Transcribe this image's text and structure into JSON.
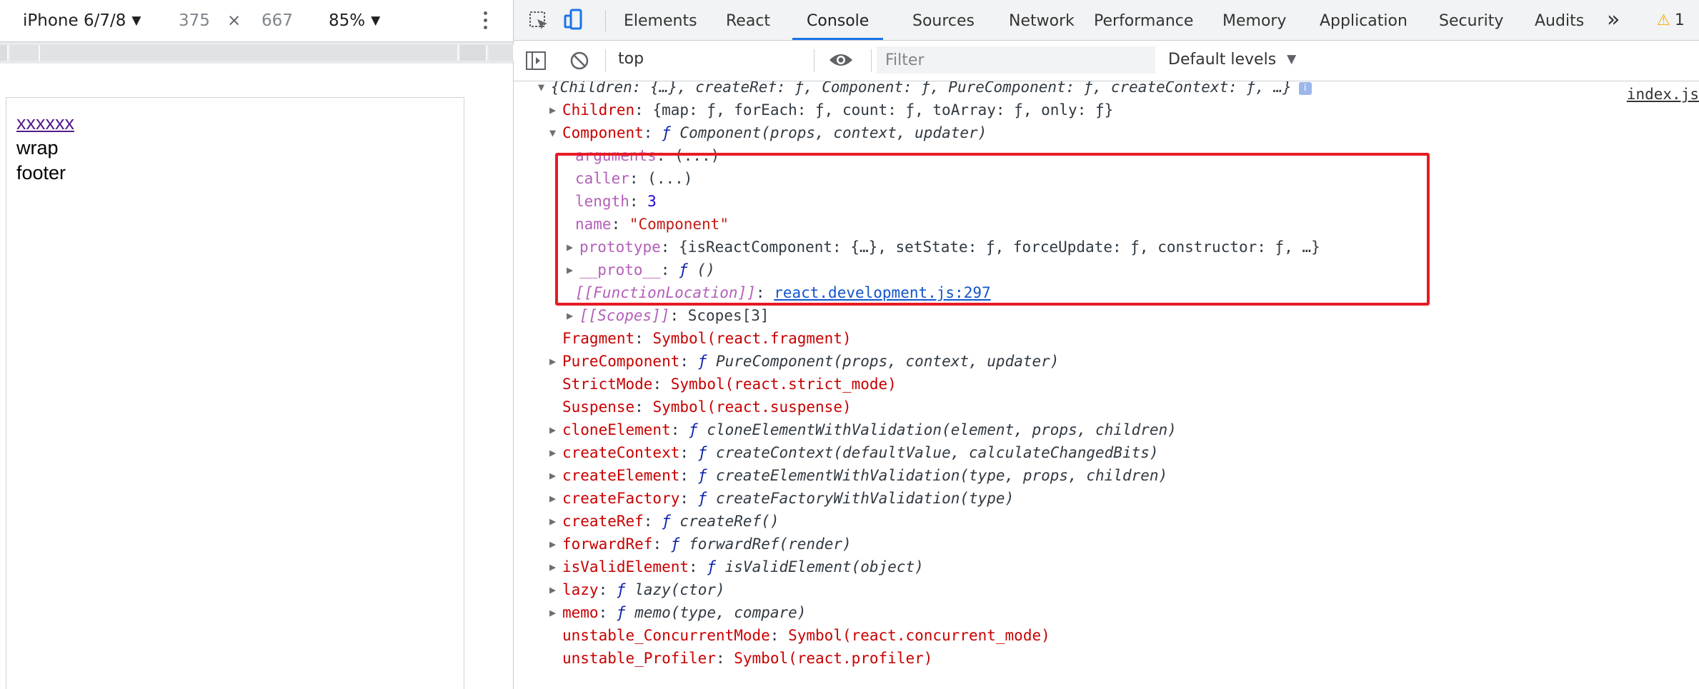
{
  "device_toolbar": {
    "device": "iPhone 6/7/8",
    "width": "375",
    "times": "×",
    "height": "667",
    "zoom": "85%",
    "caret": "▼"
  },
  "viewport": {
    "link_text": "xxxxxx",
    "wrap_text": "wrap",
    "footer_text": "footer"
  },
  "devtools": {
    "tabs": [
      "Elements",
      "React",
      "Console",
      "Sources",
      "Network",
      "Performance",
      "Memory",
      "Application",
      "Security",
      "Audits"
    ],
    "active_tab": "Console",
    "more_tabs": "»",
    "warning_icon": "⚠",
    "warning_count": "1"
  },
  "console_toolbar": {
    "context": "top",
    "filter_placeholder": "Filter",
    "levels": "Default levels",
    "caret": "▼"
  },
  "console": {
    "source_link": "index.js",
    "root": {
      "expanded_arrow": "▼",
      "summary": "{Children: {…}, createRef: ƒ, Component: ƒ, PureComponent: ƒ, createContext: ƒ, …}",
      "info": "i"
    },
    "rows": {
      "children": {
        "arrow": "▶",
        "key": "Children",
        "value": "{map: ƒ, forEach: ƒ, count: ƒ, toArray: ƒ, only: ƒ}"
      },
      "component": {
        "arrow": "▼",
        "key": "Component",
        "fsym": "ƒ",
        "sig": "Component(props, context, updater)"
      },
      "arguments": {
        "key": "arguments",
        "value": "(...)"
      },
      "caller": {
        "key": "caller",
        "value": "(...)"
      },
      "length": {
        "key": "length",
        "value": "3"
      },
      "name": {
        "key": "name",
        "value": "\"Component\""
      },
      "prototype": {
        "arrow": "▶",
        "key": "prototype",
        "value": "{isReactComponent: {…}, setState: ƒ, forceUpdate: ƒ, constructor: ƒ, …}"
      },
      "proto": {
        "arrow": "▶",
        "key": "__proto__",
        "fsym": "ƒ",
        "sig": "()"
      },
      "function_location": {
        "key": "[[FunctionLocation]]",
        "value": "react.development.js:297"
      },
      "scopes": {
        "arrow": "▶",
        "key": "[[Scopes]]",
        "value": "Scopes[3]"
      },
      "fragment": {
        "key": "Fragment",
        "value": "Symbol(react.fragment)"
      },
      "pure_component": {
        "arrow": "▶",
        "key": "PureComponent",
        "fsym": "ƒ",
        "sig": "PureComponent(props, context, updater)"
      },
      "strict_mode": {
        "key": "StrictMode",
        "value": "Symbol(react.strict_mode)"
      },
      "suspense": {
        "key": "Suspense",
        "value": "Symbol(react.suspense)"
      },
      "clone_element": {
        "arrow": "▶",
        "key": "cloneElement",
        "fsym": "ƒ",
        "sig": "cloneElementWithValidation(element, props, children)"
      },
      "create_context": {
        "arrow": "▶",
        "key": "createContext",
        "fsym": "ƒ",
        "sig": "createContext(defaultValue, calculateChangedBits)"
      },
      "create_element": {
        "arrow": "▶",
        "key": "createElement",
        "fsym": "ƒ",
        "sig": "createElementWithValidation(type, props, children)"
      },
      "create_factory": {
        "arrow": "▶",
        "key": "createFactory",
        "fsym": "ƒ",
        "sig": "createFactoryWithValidation(type)"
      },
      "create_ref": {
        "arrow": "▶",
        "key": "createRef",
        "fsym": "ƒ",
        "sig": "createRef()"
      },
      "forward_ref": {
        "arrow": "▶",
        "key": "forwardRef",
        "fsym": "ƒ",
        "sig": "forwardRef(render)"
      },
      "is_valid_element": {
        "arrow": "▶",
        "key": "isValidElement",
        "fsym": "ƒ",
        "sig": "isValidElement(object)"
      },
      "lazy": {
        "arrow": "▶",
        "key": "lazy",
        "fsym": "ƒ",
        "sig": "lazy(ctor)"
      },
      "memo": {
        "arrow": "▶",
        "key": "memo",
        "fsym": "ƒ",
        "sig": "memo(type, compare)"
      },
      "concurrent_mode": {
        "key": "unstable_ConcurrentMode",
        "value": "Symbol(react.concurrent_mode)"
      },
      "profiler": {
        "key": "unstable_Profiler",
        "value": "Symbol(react.profiler)"
      }
    },
    "colon": ":"
  },
  "colors": {
    "highlight_box": "#e51b24",
    "active_tab_underline": "#1a73e8",
    "key_red": "#c80000",
    "function_blue": "#0d22aa",
    "link_blue": "#1155cc"
  }
}
